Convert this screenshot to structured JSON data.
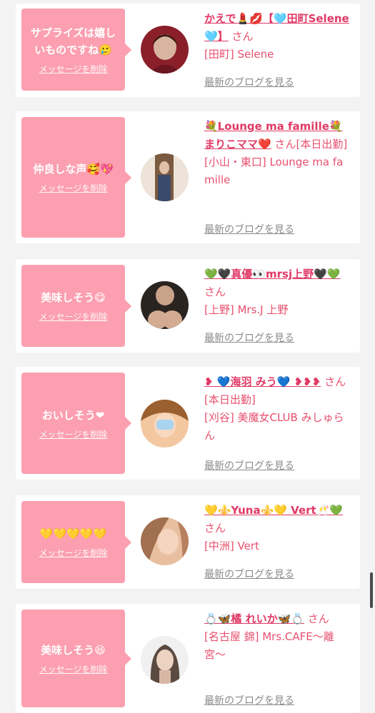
{
  "entries": [
    {
      "message": "サプライズは嬉しいものですね🥲",
      "delete_label": "メッセージを削除",
      "user_name": "かえで💄💋【🩵田町Selene🩵】",
      "suffix": "さん",
      "shop": "[田町] Selene",
      "blog_link": "最新のブログを見る",
      "avatar_colors": [
        "#8a1f2a",
        "#d8b5a0"
      ]
    },
    {
      "message": "仲良しな声🥰💖",
      "delete_label": "メッセージを削除",
      "user_name": "💐Lounge ma famille💐まりこママ❤️",
      "suffix": "さん[本日出勤]",
      "shop": "[小山・東口] Lounge ma famille",
      "blog_link": "最新のブログを見る",
      "avatar_colors": [
        "#ede3d8",
        "#7a5a40"
      ]
    },
    {
      "message": "美味しそう😋",
      "delete_label": "メッセージを削除",
      "user_name": "💚🖤真優👀mrsj上野🖤💚",
      "suffix": "さん",
      "shop": "[上野] Mrs.J 上野",
      "blog_link": "最新のブログを見る",
      "avatar_colors": [
        "#2a2420",
        "#c9a28a"
      ]
    },
    {
      "message": "おいしそう❤",
      "delete_label": "メッセージを削除",
      "user_name": "❥ 💙海羽 みう💙 ❥❥❥",
      "suffix": "さん[本日出勤]",
      "shop": "[刈谷] 美魔女CLUB みしゅらん",
      "blog_link": "最新のブログを見る",
      "avatar_colors": [
        "#f3c8a0",
        "#a8d4f0"
      ]
    },
    {
      "message": "💛💛💛💛💛",
      "delete_label": "メッセージを削除",
      "user_name": "💛⚜️Yuna⚜️💛 Vert🥂💚",
      "suffix": "さん",
      "shop": "[中洲] Vert",
      "blog_link": "最新のブログを見る",
      "avatar_colors": [
        "#e8c0a0",
        "#a07050"
      ]
    },
    {
      "message": "美味しそう😆",
      "delete_label": "メッセージを削除",
      "user_name": "💍🦋橘 れいか🦋💍",
      "suffix": "さん",
      "shop": "[名古屋 錦] Mrs.CAFE〜離宮〜",
      "blog_link": "最新のブログを見る",
      "avatar_colors": [
        "#f0f0f0",
        "#5a4a40"
      ]
    }
  ]
}
